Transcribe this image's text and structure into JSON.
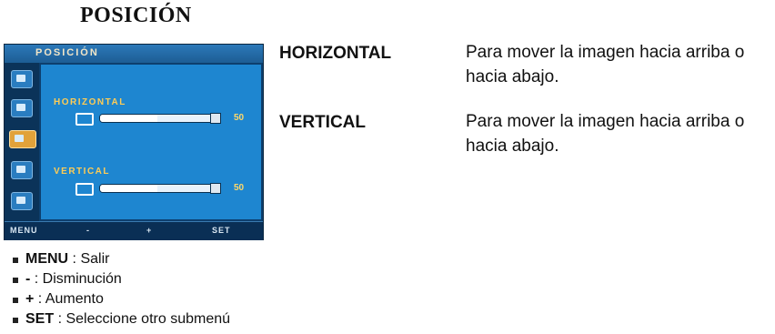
{
  "page_title": "POSICIÓN",
  "osd": {
    "title": "POSICIÓN",
    "items": [
      {
        "label": "HORIZONTAL",
        "value": "50",
        "level": 0.5
      },
      {
        "label": "VERTICAL",
        "value": "50",
        "level": 0.5
      }
    ],
    "footer": [
      "MENU",
      "-",
      "+",
      "SET"
    ],
    "colors": {
      "panel": "#1e86d0",
      "header": "#2c79b9",
      "label": "#ffcc55"
    }
  },
  "descriptions": [
    {
      "term": "HORIZONTAL",
      "text_line1": "Para mover la imagen hacia arriba o",
      "text_line2": "hacia abajo."
    },
    {
      "term": "VERTICAL",
      "text_line1": "Para mover la imagen hacia arriba o",
      "text_line2": "hacia abajo."
    }
  ],
  "legend": [
    {
      "key": "MENU",
      "text": " : Salir"
    },
    {
      "key": "-",
      "text": " : Disminución"
    },
    {
      "key": "+",
      "text": " : Aumento"
    },
    {
      "key": "SET",
      "text": " : Seleccione otro submenú"
    }
  ]
}
